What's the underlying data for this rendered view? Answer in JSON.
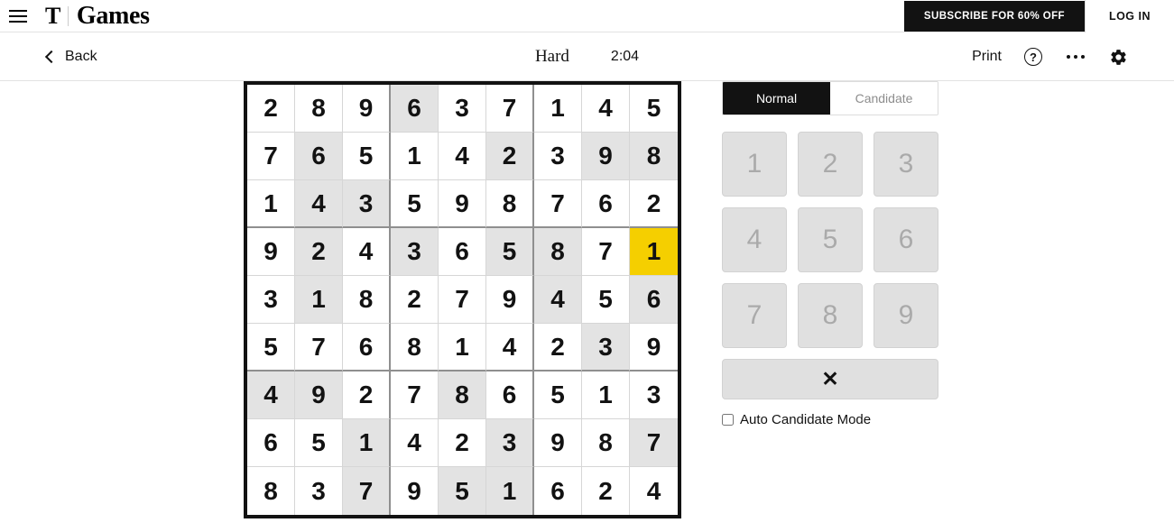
{
  "masthead": {
    "menu_icon": "hamburger-icon",
    "logo_mark": "T",
    "brand_title": "Games",
    "subscribe_label": "SUBSCRIBE FOR 60% OFF",
    "login_label": "LOG IN"
  },
  "toolbar": {
    "back_label": "Back",
    "back_icon": "chevron-left-icon",
    "difficulty": "Hard",
    "timer": "2:04",
    "print_label": "Print",
    "help_icon": "question-mark-icon",
    "help_glyph": "?",
    "more_icon": "ellipsis-icon",
    "settings_icon": "gear-icon"
  },
  "panel": {
    "modes": [
      {
        "label": "Normal",
        "active": true
      },
      {
        "label": "Candidate",
        "active": false
      }
    ],
    "numbers": [
      "1",
      "2",
      "3",
      "4",
      "5",
      "6",
      "7",
      "8",
      "9"
    ],
    "erase_label": "✕",
    "erase_icon": "erase-x-icon",
    "auto_candidate_label": "Auto Candidate Mode",
    "auto_candidate_checked": false
  },
  "colors": {
    "selected_cell": "#f5cf00",
    "shaded_cell": "#e3e3e3",
    "grid_border": "#121212",
    "block_border": "#8f8f8f",
    "cell_border": "#d6d6d6",
    "accent_dark": "#121212",
    "disabled_text": "#aaaaaa"
  },
  "sudoku": {
    "rows": 9,
    "cols": 9,
    "selected": {
      "row": 3,
      "col": 8
    },
    "values": [
      [
        "2",
        "8",
        "9",
        "6",
        "3",
        "7",
        "1",
        "4",
        "5"
      ],
      [
        "7",
        "6",
        "5",
        "1",
        "4",
        "2",
        "3",
        "9",
        "8"
      ],
      [
        "1",
        "4",
        "3",
        "5",
        "9",
        "8",
        "7",
        "6",
        "2"
      ],
      [
        "9",
        "2",
        "4",
        "3",
        "6",
        "5",
        "8",
        "7",
        "1"
      ],
      [
        "3",
        "1",
        "8",
        "2",
        "7",
        "9",
        "4",
        "5",
        "6"
      ],
      [
        "5",
        "7",
        "6",
        "8",
        "1",
        "4",
        "2",
        "3",
        "9"
      ],
      [
        "4",
        "9",
        "2",
        "7",
        "8",
        "6",
        "5",
        "1",
        "3"
      ],
      [
        "6",
        "5",
        "1",
        "4",
        "2",
        "3",
        "9",
        "8",
        "7"
      ],
      [
        "8",
        "3",
        "7",
        "9",
        "5",
        "1",
        "6",
        "2",
        "4"
      ]
    ],
    "shaded": [
      [
        false,
        false,
        false,
        true,
        false,
        false,
        false,
        false,
        false
      ],
      [
        false,
        true,
        false,
        false,
        false,
        true,
        false,
        true,
        true
      ],
      [
        false,
        true,
        true,
        false,
        false,
        false,
        false,
        false,
        false
      ],
      [
        false,
        true,
        false,
        true,
        false,
        true,
        true,
        false,
        false
      ],
      [
        false,
        true,
        false,
        false,
        false,
        false,
        true,
        false,
        true
      ],
      [
        false,
        false,
        false,
        false,
        false,
        false,
        false,
        true,
        false
      ],
      [
        true,
        true,
        false,
        false,
        true,
        false,
        false,
        false,
        false
      ],
      [
        false,
        false,
        true,
        false,
        false,
        true,
        false,
        false,
        true
      ],
      [
        false,
        false,
        true,
        false,
        true,
        true,
        false,
        false,
        false
      ]
    ]
  }
}
